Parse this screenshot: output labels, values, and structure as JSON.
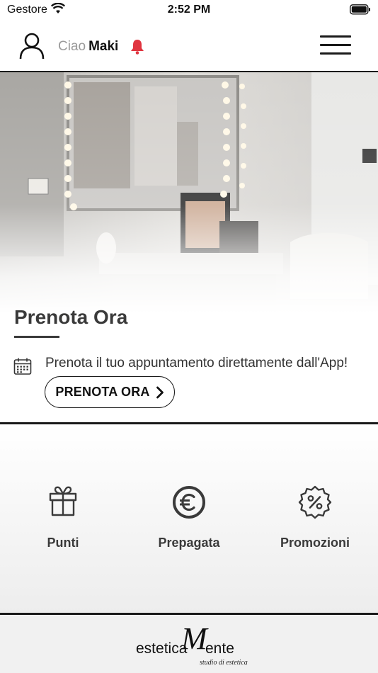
{
  "status_bar": {
    "carrier": "Gestore",
    "time": "2:52 PM"
  },
  "header": {
    "greeting": "Ciao",
    "user_name": "Maki",
    "bell_color": "#e0343f"
  },
  "hero": {
    "title": "Prenota Ora",
    "description": "Prenota il tuo appuntamento direttamente dall'App!",
    "button_label": "PRENOTA ORA"
  },
  "features": [
    {
      "label": "Punti",
      "icon": "gift-icon"
    },
    {
      "label": "Prepagata",
      "icon": "euro-icon"
    },
    {
      "label": "Promozioni",
      "icon": "discount-badge-icon"
    }
  ],
  "footer": {
    "logo_word_1": "estetica",
    "logo_letter": "M",
    "logo_word_2": "ente",
    "logo_tagline": "studio di estetica"
  }
}
